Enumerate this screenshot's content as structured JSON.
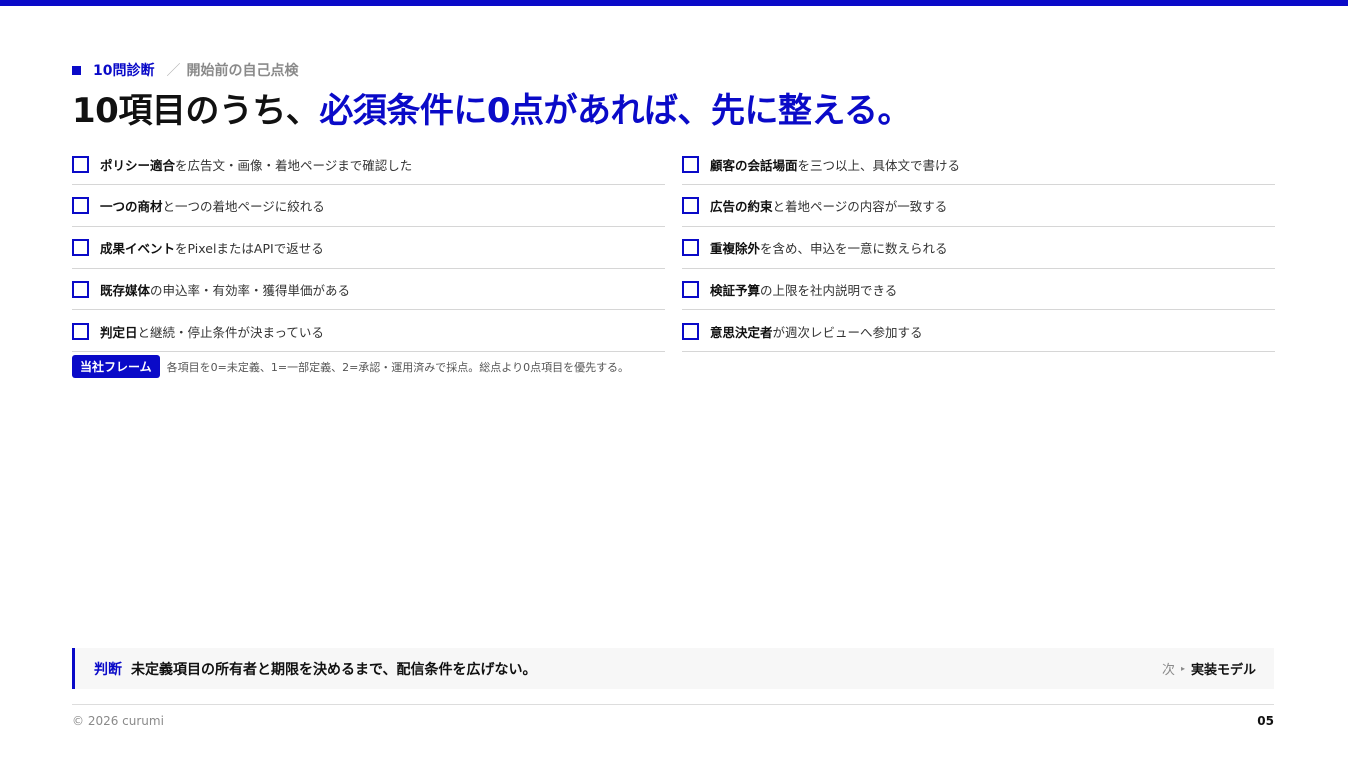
{
  "kicker": {
    "main": "10問診断",
    "separator": "／",
    "sub": "開始前の自己点検"
  },
  "headline": {
    "lead": "10項目のうち、",
    "accent": "必須条件に0点があれば、先に整える。"
  },
  "checklist": {
    "left": [
      {
        "strong": "ポリシー適合",
        "rest": "を広告文・画像・着地ページまで確認した"
      },
      {
        "strong": "一つの商材",
        "rest": "と一つの着地ページに絞れる"
      },
      {
        "strong": "成果イベント",
        "rest": "をPixelまたはAPIで返せる"
      },
      {
        "strong": "既存媒体",
        "rest": "の申込率・有効率・獲得単価がある"
      },
      {
        "strong": "判定日",
        "rest": "と継続・停止条件が決まっている"
      }
    ],
    "right": [
      {
        "strong": "顧客の会話場面",
        "rest": "を三つ以上、具体文で書ける"
      },
      {
        "strong": "広告の約束",
        "rest": "と着地ページの内容が一致する"
      },
      {
        "strong": "重複除外",
        "rest": "を含め、申込を一意に数えられる"
      },
      {
        "strong": "検証予算",
        "rest": "の上限を社内説明できる"
      },
      {
        "strong": "意思決定者",
        "rest": "が週次レビューへ参加する"
      }
    ]
  },
  "note": {
    "badge": "当社フレーム",
    "text": "各項目を0=未定義、1=一部定義、2=承認・運用済みで採点。総点より0点項目を優先する。"
  },
  "judgement": {
    "label": "判断",
    "text": "未定義項目の所有者と期限を決めるまで、配信条件を広げない。",
    "next_label": "次",
    "next_arrow": "▸",
    "next_target": "実装モデル"
  },
  "footer": {
    "copyright": "© 2026 curumi",
    "page": "05"
  },
  "colors": {
    "accent": "#0a0ac8",
    "text": "#111111",
    "muted": "#8a8a8a"
  }
}
